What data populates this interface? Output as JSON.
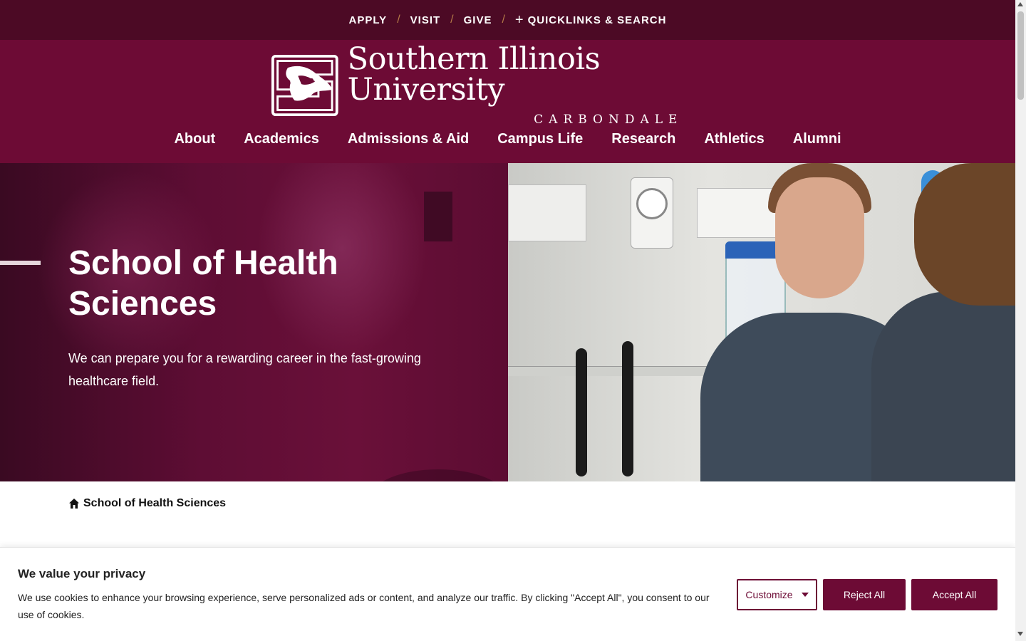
{
  "utility_nav": {
    "items": [
      "APPLY",
      "VISIT",
      "GIVE"
    ],
    "quicklinks_label": "QUICKLINKS & SEARCH",
    "separator": "/"
  },
  "logo": {
    "name": "Southern Illinois University",
    "campus": "CARBONDALE"
  },
  "main_nav": {
    "items": [
      "About",
      "Academics",
      "Admissions & Aid",
      "Campus Life",
      "Research",
      "Athletics",
      "Alumni"
    ]
  },
  "hero": {
    "title": "School of Health Sciences",
    "description": "We can prepare you for a rewarding career in the fast-growing healthcare field."
  },
  "breadcrumb": {
    "label": "School of Health Sciences",
    "icon": "home-icon"
  },
  "cookie_banner": {
    "title": "We value your privacy",
    "text": "We use cookies to enhance your browsing experience, serve personalized ads or content, and analyze our traffic. By clicking \"Accept All\", you consent to our use of cookies.",
    "customize_label": "Customize",
    "reject_label": "Reject All",
    "accept_label": "Accept All"
  },
  "colors": {
    "brand_maroon": "#6d0b35",
    "utility_bar": "#4c0a25",
    "separator": "#b57b48"
  }
}
